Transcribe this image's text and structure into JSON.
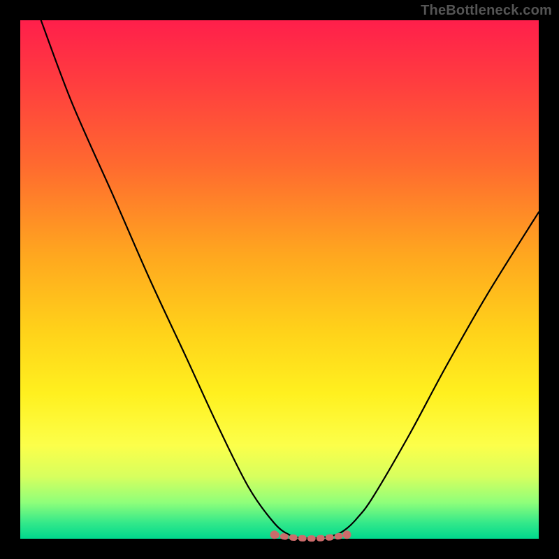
{
  "watermark": "TheBottleneck.com",
  "chart_data": {
    "type": "line",
    "title": "",
    "xlabel": "",
    "ylabel": "",
    "xlim": [
      0,
      100
    ],
    "ylim": [
      0,
      100
    ],
    "grid": false,
    "legend": false,
    "series": [
      {
        "name": "bottleneck-curve",
        "x": [
          4,
          10,
          18,
          25,
          32,
          38,
          44,
          49,
          52,
          54,
          55.5,
          58,
          61,
          63,
          65,
          68,
          75,
          82,
          90,
          100
        ],
        "y": [
          100,
          84,
          66,
          50,
          35,
          22,
          10,
          3,
          0.7,
          0.2,
          0.1,
          0.2,
          0.8,
          2,
          4,
          8,
          20,
          33,
          47,
          63
        ],
        "color": "#000000"
      }
    ],
    "highlight": {
      "name": "least-bottleneck-band",
      "color": "#cc6b6b",
      "x_range": [
        49,
        63
      ],
      "y_approx": 0.5
    },
    "gradient_meaning": "top = worst (red), bottom = best (green)"
  }
}
